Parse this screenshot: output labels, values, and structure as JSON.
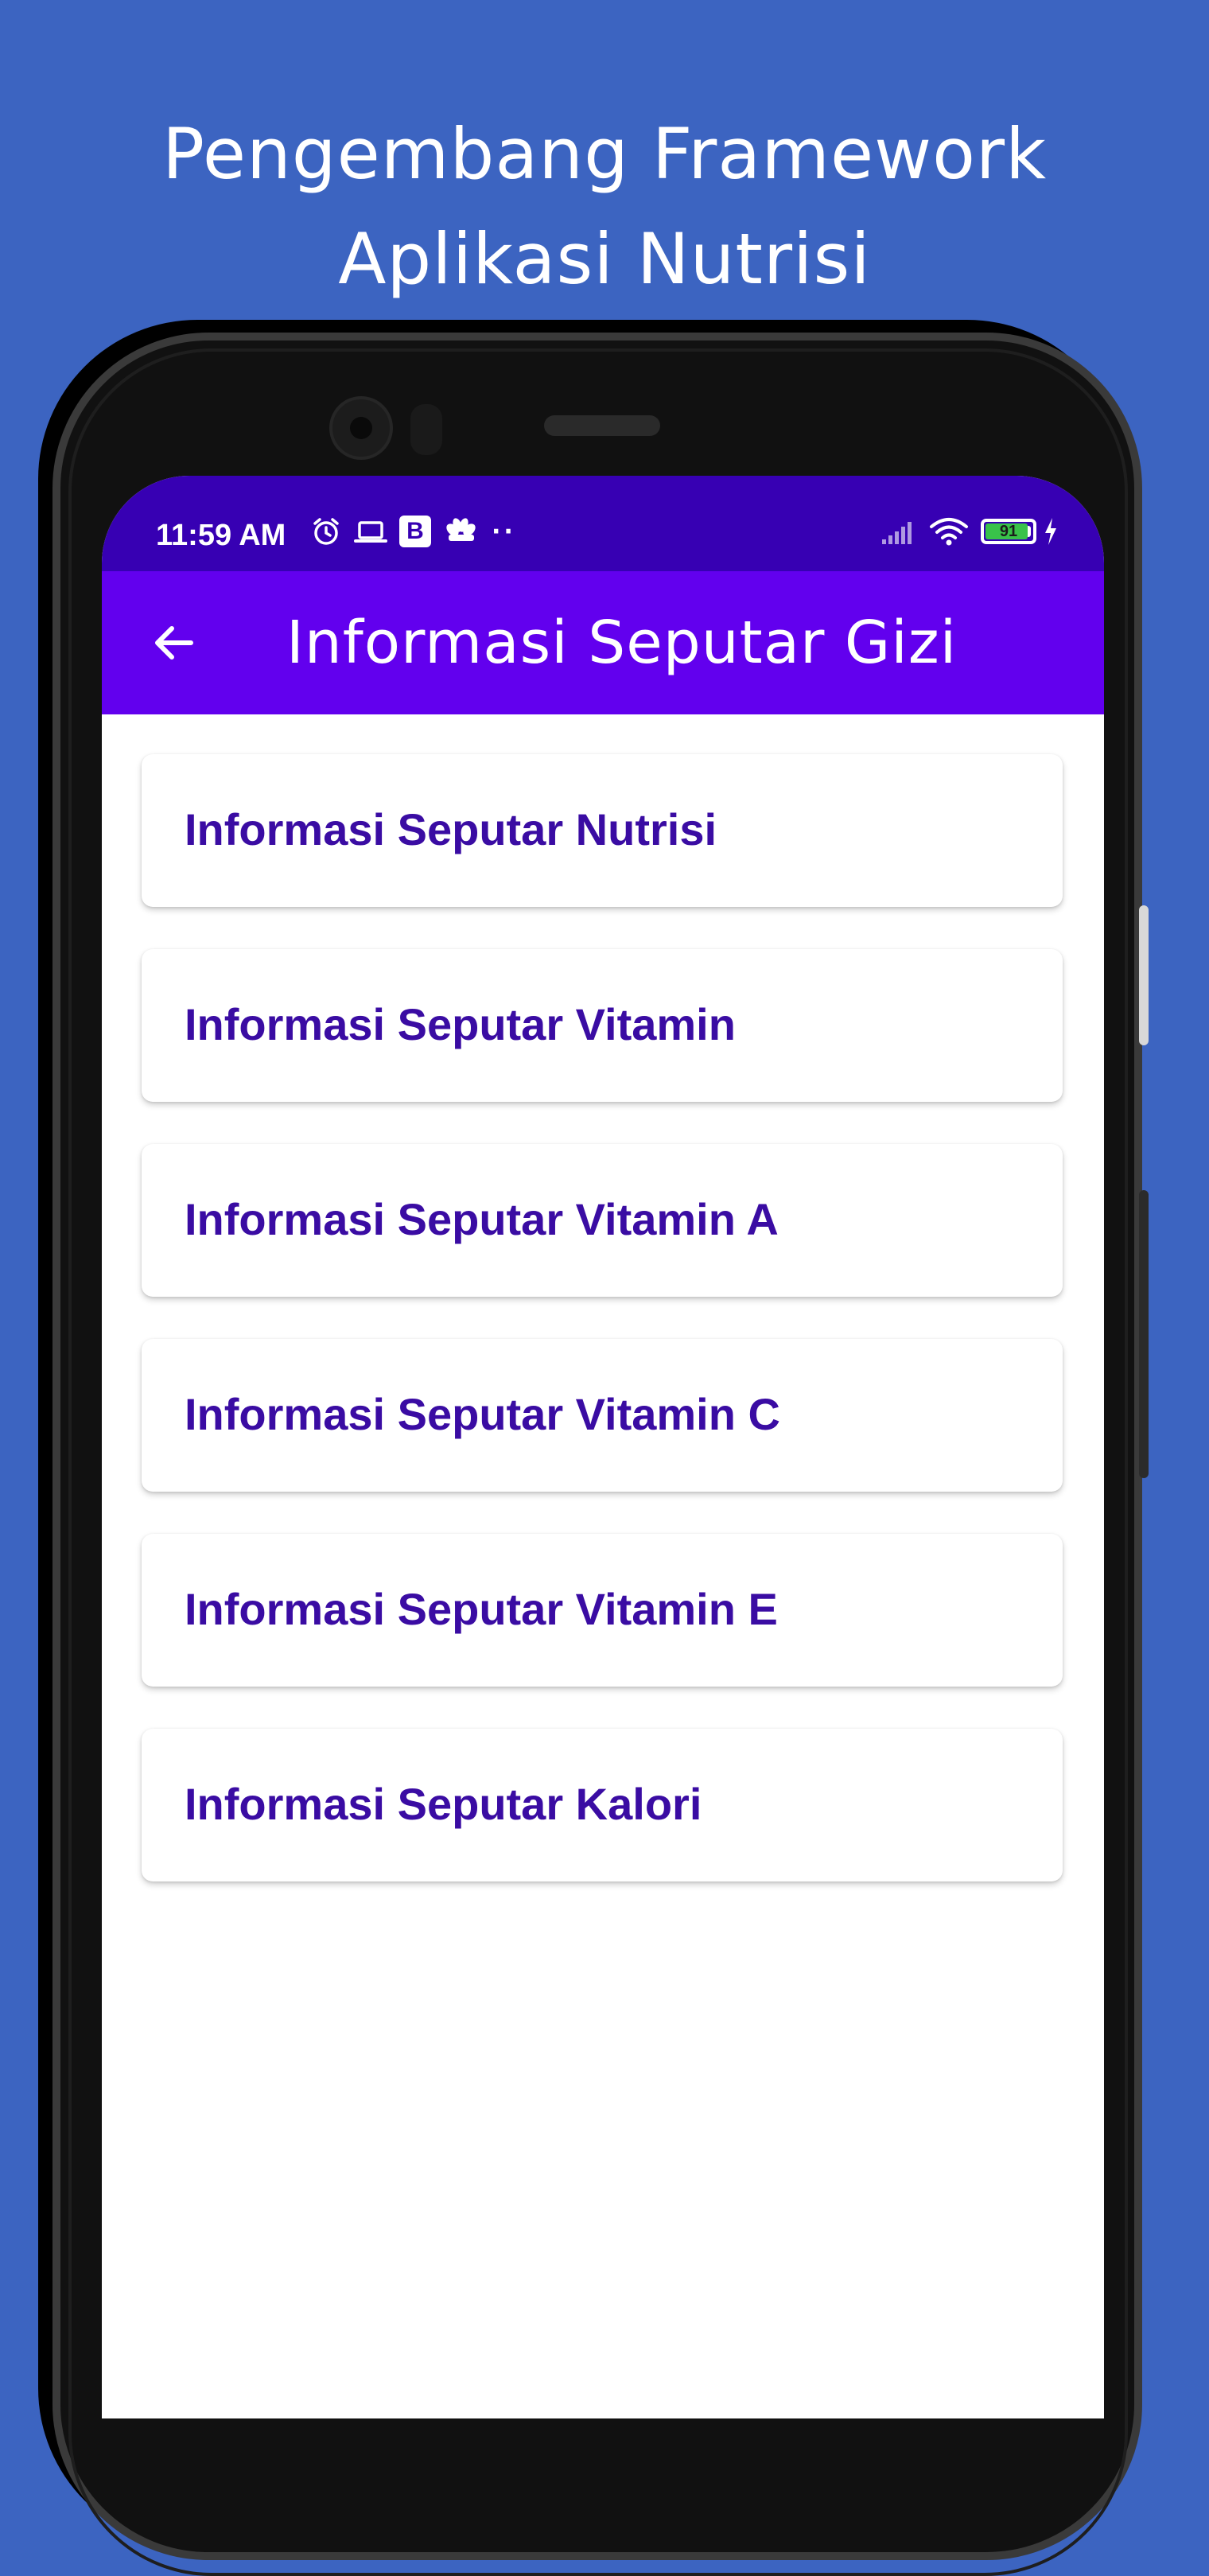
{
  "banner": {
    "line1": "Pengembang Framework",
    "line2": "Aplikasi Nutrisi"
  },
  "status_bar": {
    "time": "11:59 AM",
    "badge_letter": "B",
    "overflow_dots": "··",
    "battery_level": "91",
    "left_icons": [
      "alarm-icon",
      "laptop-icon",
      "b-app-icon",
      "nbc-icon"
    ],
    "right_icons": [
      "signal-icon",
      "wifi-icon",
      "battery-icon",
      "charging-icon"
    ]
  },
  "app_bar": {
    "title": "Informasi Seputar Gizi",
    "back_icon": "arrow-left-icon"
  },
  "menu": {
    "items": [
      {
        "label": "Informasi Seputar Nutrisi"
      },
      {
        "label": "Informasi Seputar Vitamin"
      },
      {
        "label": "Informasi Seputar Vitamin A"
      },
      {
        "label": "Informasi Seputar Vitamin C"
      },
      {
        "label": "Informasi Seputar Vitamin E"
      },
      {
        "label": "Informasi Seputar Kalori"
      }
    ]
  },
  "colors": {
    "background": "#3c64c1",
    "status_bar": "#3700b3",
    "app_bar": "#6200ee",
    "item_text": "#3a0ca3",
    "battery_fill": "#39c24a"
  }
}
